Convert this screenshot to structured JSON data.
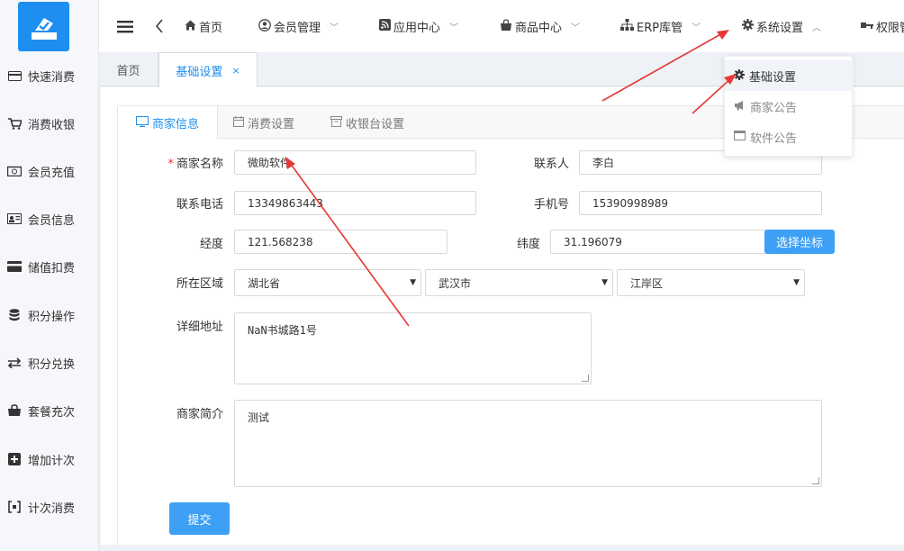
{
  "sidebar": {
    "items": [
      {
        "label": "快速消费",
        "icon": "card-icon"
      },
      {
        "label": "消费收银",
        "icon": "cart-icon"
      },
      {
        "label": "会员充值",
        "icon": "money-icon"
      },
      {
        "label": "会员信息",
        "icon": "id-card-icon"
      },
      {
        "label": "储值扣费",
        "icon": "credit-card-icon"
      },
      {
        "label": "积分操作",
        "icon": "database-icon"
      },
      {
        "label": "积分兑换",
        "icon": "exchange-icon"
      },
      {
        "label": "套餐充次",
        "icon": "bag-icon"
      },
      {
        "label": "增加计次",
        "icon": "plus-square-icon"
      },
      {
        "label": "计次消费",
        "icon": "bracket-icon"
      }
    ]
  },
  "topnav": {
    "items": [
      {
        "label": "首页",
        "icon": "home-icon",
        "chevron": ""
      },
      {
        "label": "会员管理",
        "icon": "user-circle-icon",
        "chevron": "﹀"
      },
      {
        "label": "应用中心",
        "icon": "rss-icon",
        "chevron": "﹀"
      },
      {
        "label": "商品中心",
        "icon": "shopping-bag-icon",
        "chevron": "﹀"
      },
      {
        "label": "ERP库管",
        "icon": "sitemap-icon",
        "chevron": "﹀"
      },
      {
        "label": "系统设置",
        "icon": "gear-icon",
        "chevron": "︿"
      },
      {
        "label": "权限管",
        "icon": "key-icon",
        "chevron": ""
      }
    ]
  },
  "tabbar": {
    "home": "首页",
    "active": "基础设置",
    "close": "×"
  },
  "subtabs": [
    "商家信息",
    "消费设置",
    "收银台设置"
  ],
  "form": {
    "merchant_name_label": "商家名称",
    "required_mark": "*",
    "merchant_name": "微助软件",
    "contact_label": "联系人",
    "contact": "李白",
    "phone_label": "联系电话",
    "phone": "13349863443",
    "mobile_label": "手机号",
    "mobile": "15390998989",
    "lng_label": "经度",
    "lng": "121.568238",
    "lat_label": "纬度",
    "lat": "31.196079",
    "pick_coords": "选择坐标",
    "region_label": "所在区域",
    "province": "湖北省",
    "city": "武汉市",
    "district": "江岸区",
    "address_label": "详细地址",
    "address": "NaN书城路1号",
    "intro_label": "商家简介",
    "intro": "测试",
    "submit": "提交"
  },
  "dropdown": {
    "items": [
      {
        "label": "基础设置",
        "icon": "gear-icon"
      },
      {
        "label": "商家公告",
        "icon": "megaphone-icon"
      },
      {
        "label": "软件公告",
        "icon": "window-icon"
      }
    ]
  },
  "colors": {
    "accent": "#1e8ff0",
    "button": "#3ea0f5",
    "annotation": "#e53935"
  }
}
